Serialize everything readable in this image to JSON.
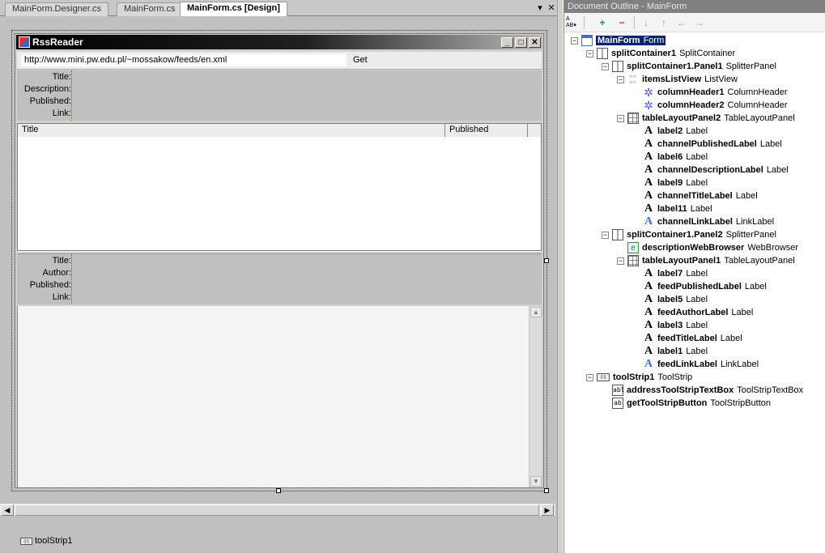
{
  "document_tabs": [
    {
      "label": "MainForm.Designer.cs",
      "active": false
    },
    {
      "label": "MainForm.cs",
      "active": false
    },
    {
      "label": "MainForm.cs [Design]",
      "active": true
    }
  ],
  "tab_controls": {
    "dropdown": "▾",
    "close": "✕"
  },
  "form": {
    "title": "RssReader",
    "caption_buttons": {
      "minimize": "_",
      "maximize": "□",
      "close": "✕"
    },
    "address_value": "http://www.mini.pw.edu.pl/~mossakow/feeds/en.xml",
    "get_button": "Get",
    "channel_labels": [
      "Title:",
      "Description:",
      "Published:",
      "Link:"
    ],
    "list_columns": [
      "Title",
      "Published"
    ],
    "feed_labels": [
      "Title:",
      "Author:",
      "Published:",
      "Link:"
    ]
  },
  "tray": {
    "item": "toolStrip1"
  },
  "outline": {
    "title": "Document Outline - MainForm",
    "toolbar": [
      "move-up",
      "add",
      "remove",
      "down",
      "up",
      "left",
      "right"
    ],
    "nodes": [
      {
        "name": "MainForm",
        "type": "Form",
        "icon": "form-icon",
        "expander": "−",
        "selected": true
      },
      {
        "name": "splitContainer1",
        "type": "SplitContainer",
        "icon": "split-icon",
        "expander": "−"
      },
      {
        "name": "splitContainer1.Panel1",
        "type": "SplitterPanel",
        "icon": "split-icon",
        "expander": "−"
      },
      {
        "name": "itemsListView",
        "type": "ListView",
        "icon": "listview-icon",
        "expander": "−"
      },
      {
        "name": "columnHeader1",
        "type": "ColumnHeader",
        "icon": "gear-icon"
      },
      {
        "name": "columnHeader2",
        "type": "ColumnHeader",
        "icon": "gear-icon"
      },
      {
        "name": "tableLayoutPanel2",
        "type": "TableLayoutPanel",
        "icon": "table-icon",
        "expander": "−"
      },
      {
        "name": "label2",
        "type": "Label",
        "icon": "label-icon"
      },
      {
        "name": "channelPublishedLabel",
        "type": "Label",
        "icon": "label-icon"
      },
      {
        "name": "label6",
        "type": "Label",
        "icon": "label-icon"
      },
      {
        "name": "channelDescriptionLabel",
        "type": "Label",
        "icon": "label-icon"
      },
      {
        "name": "label9",
        "type": "Label",
        "icon": "label-icon"
      },
      {
        "name": "channelTitleLabel",
        "type": "Label",
        "icon": "label-icon"
      },
      {
        "name": "label11",
        "type": "Label",
        "icon": "label-icon"
      },
      {
        "name": "channelLinkLabel",
        "type": "LinkLabel",
        "icon": "linklabel-icon"
      },
      {
        "name": "splitContainer1.Panel2",
        "type": "SplitterPanel",
        "icon": "split-icon",
        "expander": "−"
      },
      {
        "name": "descriptionWebBrowser",
        "type": "WebBrowser",
        "icon": "webbrowser-icon"
      },
      {
        "name": "tableLayoutPanel1",
        "type": "TableLayoutPanel",
        "icon": "table-icon",
        "expander": "−"
      },
      {
        "name": "label7",
        "type": "Label",
        "icon": "label-icon"
      },
      {
        "name": "feedPublishedLabel",
        "type": "Label",
        "icon": "label-icon"
      },
      {
        "name": "label5",
        "type": "Label",
        "icon": "label-icon"
      },
      {
        "name": "feedAuthorLabel",
        "type": "Label",
        "icon": "label-icon"
      },
      {
        "name": "label3",
        "type": "Label",
        "icon": "label-icon"
      },
      {
        "name": "feedTitleLabel",
        "type": "Label",
        "icon": "label-icon"
      },
      {
        "name": "label1",
        "type": "Label",
        "icon": "label-icon"
      },
      {
        "name": "feedLinkLabel",
        "type": "LinkLabel",
        "icon": "linklabel-icon"
      },
      {
        "name": "toolStrip1",
        "type": "ToolStrip",
        "icon": "toolstrip-icon",
        "expander": "−"
      },
      {
        "name": "addressToolStripTextBox",
        "type": "ToolStripTextBox",
        "icon": "textbox-icon"
      },
      {
        "name": "getToolStripButton",
        "type": "ToolStripButton",
        "icon": "button-icon"
      }
    ]
  },
  "colors": {
    "selection": "#0a246a",
    "designer_bg": "#c0c0c0",
    "title_bar": "#000000"
  }
}
